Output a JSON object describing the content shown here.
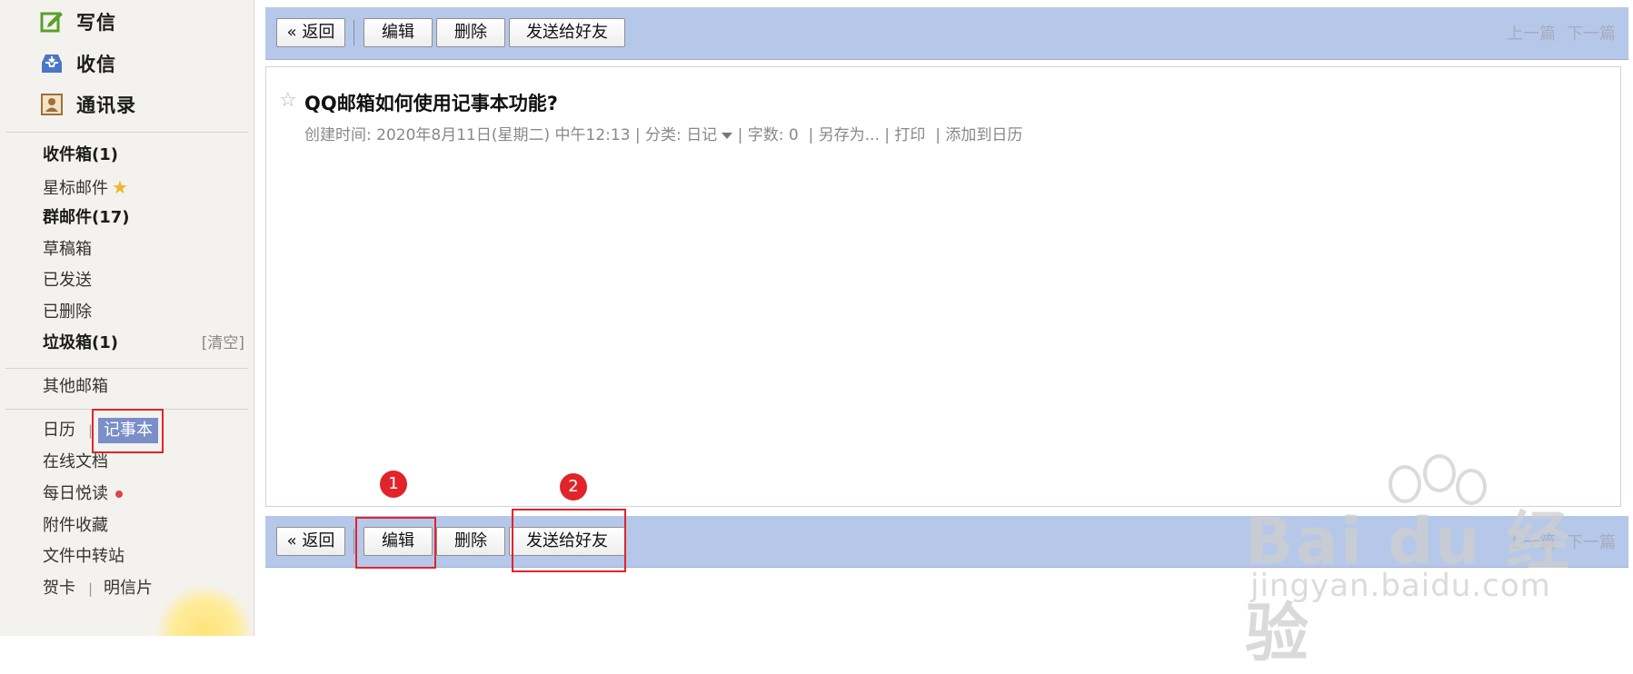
{
  "sidebar": {
    "compose_label": "写信",
    "inbox_action_label": "收信",
    "contacts_label": "通讯录",
    "folders": [
      {
        "label": "收件箱(1)",
        "bold": true
      },
      {
        "label": "星标邮件",
        "bold": false
      },
      {
        "label": "群邮件(17)",
        "bold": true
      },
      {
        "label": "草稿箱",
        "bold": false
      },
      {
        "label": "已发送",
        "bold": false
      },
      {
        "label": "已删除",
        "bold": false
      },
      {
        "label": "垃圾箱(1)",
        "bold": true
      }
    ],
    "clear_label": "[清空]",
    "other_mailbox": "其他邮箱",
    "calendar": "日历",
    "notebook": "记事本",
    "online_docs": "在线文档",
    "daily_read": "每日悦读",
    "attachments": "附件收藏",
    "file_transfer": "文件中转站",
    "greeting_card": "贺卡",
    "postcard": "明信片"
  },
  "toolbar": {
    "back": "« 返回",
    "edit": "编辑",
    "delete": "删除",
    "send_to_friend": "发送给好友",
    "prev": "上一篇",
    "next": "下一篇"
  },
  "note": {
    "title": "QQ邮箱如何使用记事本功能?",
    "created_label": "创建时间:",
    "created_value": "2020年8月11日(星期二) 中午12:13",
    "category_label": "| 分类:",
    "category_value": "日记",
    "wordcount_label": "| 字数:",
    "wordcount_value": "0",
    "save_as": "| 另存为...",
    "print": "| 打印",
    "add_calendar": "| 添加到日历"
  },
  "annotations": {
    "badge1": "1",
    "badge2": "2",
    "highlight_color": "#e1242a"
  },
  "watermark": {
    "logo": "Bai du 经验",
    "url": "jingyan.baidu.com"
  },
  "colors": {
    "toolbar_bg": "#b6c8e9",
    "sidebar_bg": "#f4f2ee",
    "selected_bg": "#7a8ec9"
  }
}
